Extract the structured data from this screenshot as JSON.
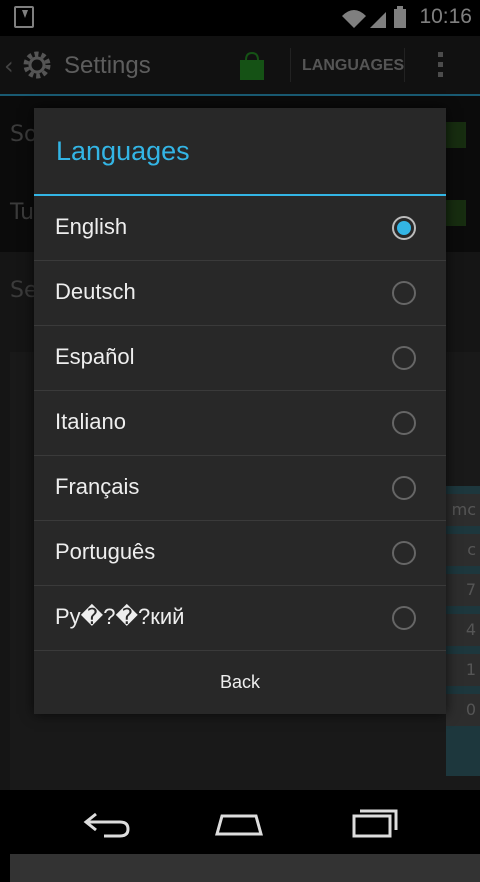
{
  "status_bar": {
    "time": "10:16"
  },
  "action_bar": {
    "title": "Settings",
    "languages_label": "LANGUAGES"
  },
  "background": {
    "row1_label": "So",
    "row2_label": "Tu",
    "row3_label": "Se"
  },
  "dialog": {
    "title": "Languages",
    "options": [
      {
        "label": "English",
        "selected": true
      },
      {
        "label": "Deutsch",
        "selected": false
      },
      {
        "label": "Español",
        "selected": false
      },
      {
        "label": "Italiano",
        "selected": false
      },
      {
        "label": "Français",
        "selected": false
      },
      {
        "label": "Português",
        "selected": false
      },
      {
        "label": "Ру�?�?кий",
        "selected": false
      }
    ],
    "back_label": "Back"
  },
  "side_keys": [
    "mc",
    "c",
    "7",
    "4",
    "1",
    "0"
  ],
  "colors": {
    "accent": "#33b5e5",
    "action_bar": "#222222",
    "dialog": "#282828"
  }
}
